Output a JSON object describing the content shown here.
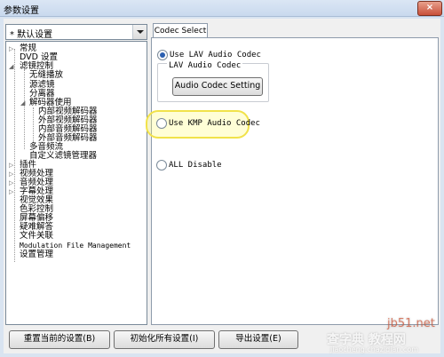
{
  "window": {
    "title": "参数设置",
    "close_glyph": "×"
  },
  "profile": {
    "selected": "* 默认设置"
  },
  "tree": [
    {
      "label": "常规",
      "expander": "▷",
      "level": 0
    },
    {
      "label": "DVD 设置",
      "level": 0
    },
    {
      "label": "滤镜控制",
      "expander": "◢",
      "level": 0
    },
    {
      "label": "无缝播放",
      "level": 1
    },
    {
      "label": "源滤镜",
      "level": 1
    },
    {
      "label": "分离器",
      "level": 1
    },
    {
      "label": "解码器使用",
      "expander": "◢",
      "level": 1
    },
    {
      "label": "内部视频解码器",
      "level": 2
    },
    {
      "label": "外部视频解码器",
      "level": 2
    },
    {
      "label": "内部音频解码器",
      "level": 2
    },
    {
      "label": "外部音频解码器",
      "level": 2
    },
    {
      "label": "多音频流",
      "level": 1
    },
    {
      "label": "自定义滤镜管理器",
      "level": 1
    },
    {
      "label": "插件",
      "expander": "▷",
      "level": 0
    },
    {
      "label": "视频处理",
      "expander": "▷",
      "level": 0
    },
    {
      "label": "音频处理",
      "expander": "▷",
      "level": 0
    },
    {
      "label": "字幕处理",
      "expander": "▷",
      "level": 0
    },
    {
      "label": "视觉效果",
      "level": 0
    },
    {
      "label": "色彩控制",
      "level": 0
    },
    {
      "label": "屏幕偏移",
      "level": 0
    },
    {
      "label": "疑难解答",
      "level": 0
    },
    {
      "label": "文件关联",
      "level": 0
    },
    {
      "label": "Modulation File Management",
      "level": 0
    },
    {
      "label": "设置管理",
      "level": 0
    }
  ],
  "tab": {
    "label": "Codec Select"
  },
  "options": {
    "lav": {
      "label": "Use LAV Audio Codec",
      "checked": true
    },
    "group_title": "LAV Audio Codec",
    "setting_button": "Audio Codec Setting",
    "kmp": {
      "label": "Use KMP Audio Codec",
      "checked": false
    },
    "disable": {
      "label": "ALL Disable",
      "checked": false
    }
  },
  "footer": {
    "reset_current": "重置当前的设置(B)",
    "init_all": "初始化所有设置(I)",
    "export": "导出设置(E)"
  },
  "watermark": {
    "site": "jb51.net",
    "brand": "查字典 教程网",
    "url": "jiaocheng.chazidian.com"
  },
  "colors": {
    "highlight": "#f1e24a",
    "radio_accent": "#2a5fb0"
  }
}
